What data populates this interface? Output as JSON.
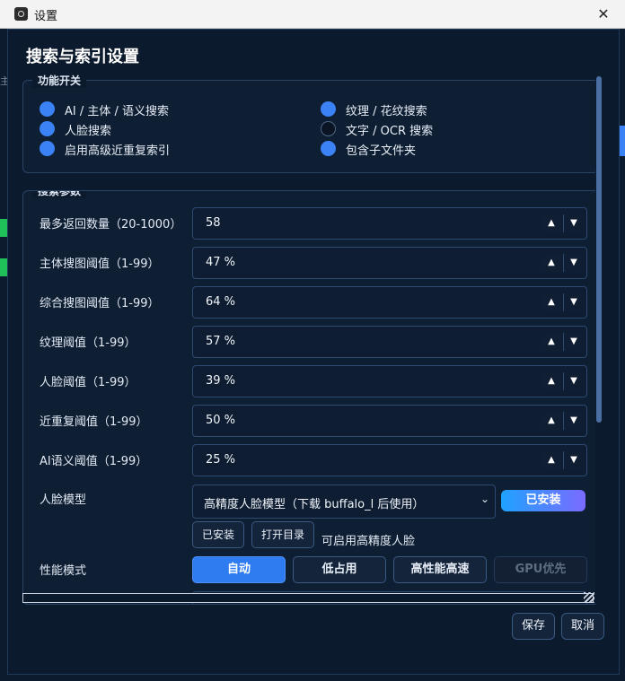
{
  "window": {
    "title": "设置",
    "close_label": "✕"
  },
  "background": {
    "left_text": "主"
  },
  "dialog": {
    "heading": "搜索与索引设置",
    "func_group": {
      "title": "功能开关",
      "items": [
        {
          "label": "AI / 主体 / 语义搜索",
          "checked": true
        },
        {
          "label": "纹理 / 花纹搜索",
          "checked": true
        },
        {
          "label": "人脸搜索",
          "checked": true
        },
        {
          "label": "文字 / OCR 搜索",
          "checked": false
        },
        {
          "label": "启用高级近重复索引",
          "checked": true
        },
        {
          "label": "包含子文件夹",
          "checked": true
        }
      ]
    },
    "search_group": {
      "title": "搜索参数",
      "rows": [
        {
          "label": "最多返回数量（20-1000）",
          "value": "58"
        },
        {
          "label": "主体搜图阈值（1-99）",
          "value": "47 %"
        },
        {
          "label": "综合搜图阈值（1-99）",
          "value": "64 %"
        },
        {
          "label": "纹理阈值（1-99）",
          "value": "57 %"
        },
        {
          "label": "人脸阈值（1-99）",
          "value": "39 %"
        },
        {
          "label": "近重复阈值（1-99）",
          "value": "50 %"
        },
        {
          "label": "AI语义阈值（1-99）",
          "value": "25 %"
        }
      ],
      "face_model": {
        "label": "人脸模型",
        "selected": "高精度人脸模型（下载 buffalo_l 后使用）",
        "status_pill": "已安装",
        "installed_button": "已安装",
        "open_dir_button": "打开目录",
        "hint": "可启用高精度人脸"
      },
      "performance": {
        "label": "性能模式",
        "modes": [
          "自动",
          "低占用",
          "高性能高速",
          "GPU优先"
        ],
        "active": "自动",
        "disabled": "GPU优先"
      }
    },
    "footer": {
      "save": "保存",
      "cancel": "取消"
    }
  },
  "icons": {
    "up": "▲",
    "down": "▼",
    "caret": "⌄"
  }
}
